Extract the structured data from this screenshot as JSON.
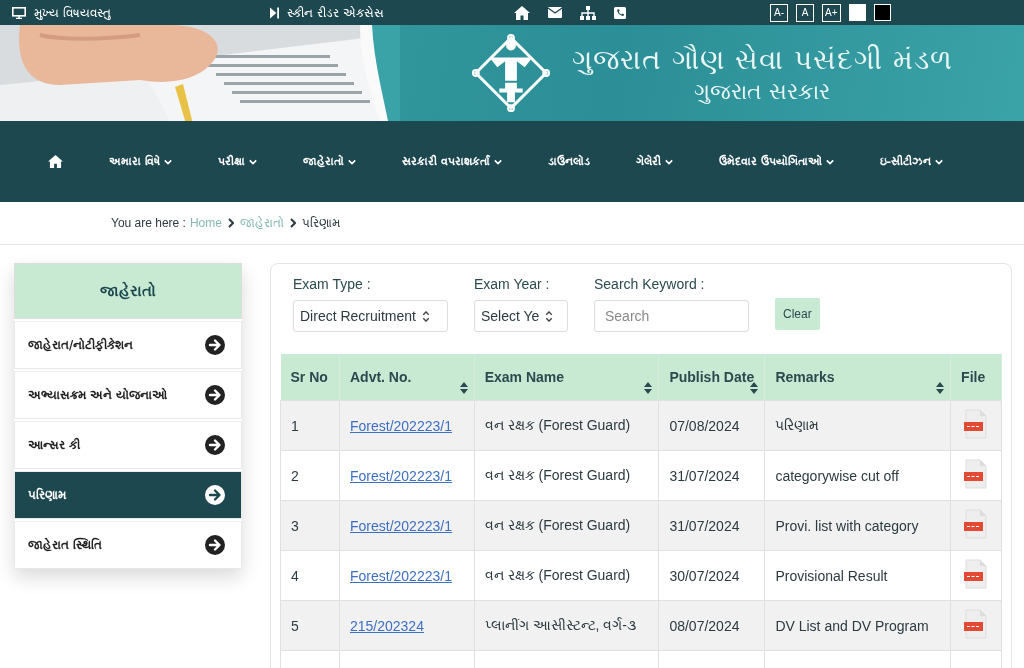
{
  "top_bar": {
    "skip_link": "મુખ્ય વિષયવસ્તુ",
    "screen_reader": "સ્કીન રીડર એક્સેસ",
    "font_buttons": [
      "A-",
      "A",
      "A+"
    ],
    "contrast_options": [
      {
        "color": "#ffffff"
      },
      {
        "color": "#000000"
      }
    ]
  },
  "banner": {
    "title": "ગુજરાત ગૌણ સેવા પસંદગી મંડળ",
    "subtitle": "ગુજરાત સરકાર"
  },
  "nav": [
    {
      "label": "અમારા વિષે",
      "dropdown": true
    },
    {
      "label": "પરીક્ષા",
      "dropdown": true
    },
    {
      "label": "જાહેરાતો",
      "dropdown": true
    },
    {
      "label": "સરકારી વપરાશકર્તા",
      "dropdown": true
    },
    {
      "label": "ડાઉનલોડ",
      "dropdown": false
    },
    {
      "label": "ગેલેરી",
      "dropdown": true
    },
    {
      "label": "ઉમેદવાર ઉપયોગિતાઓ",
      "dropdown": true
    },
    {
      "label": "ઇ-સીટીઝન",
      "dropdown": true
    }
  ],
  "breadcrumb": {
    "label": "You are here :",
    "links": [
      "Home",
      "જાહેરાતો"
    ],
    "current": "પરિણામ"
  },
  "sidebar": {
    "title": "જાહેરાતો",
    "items": [
      {
        "label": "જાહેરાત/નોટીફીકેશન",
        "selected": false
      },
      {
        "label": "અભ્યાસક્રમ અને યોજનાઓ",
        "selected": false
      },
      {
        "label": "આન્સર કી",
        "selected": false
      },
      {
        "label": "પરિણામ",
        "selected": true
      },
      {
        "label": "જાહેરાત સ્થિતિ",
        "selected": false
      }
    ]
  },
  "filters": {
    "exam_type": {
      "label": "Exam Type :",
      "value": "Direct Recruitment"
    },
    "exam_year": {
      "label": "Exam Year :",
      "value": "Select Ye"
    },
    "search": {
      "label": "Search Keyword :",
      "placeholder": "Search"
    },
    "clear_button": "Clear"
  },
  "table": {
    "columns": [
      {
        "label": "Sr No",
        "sortable": false
      },
      {
        "label": "Advt. No.",
        "sortable": true
      },
      {
        "label": "Exam Name",
        "sortable": true
      },
      {
        "label": "Publish Date",
        "sortable": true
      },
      {
        "label": "Remarks",
        "sortable": true
      },
      {
        "label": "File",
        "sortable": false
      }
    ],
    "rows": [
      {
        "sr": "1",
        "advt": "Forest/202223/1",
        "exam": "વન રક્ષક (Forest Guard)",
        "date": "07/08/2024",
        "remarks": "પરિણામ"
      },
      {
        "sr": "2",
        "advt": "Forest/202223/1",
        "exam": "વન રક્ષક (Forest Guard)",
        "date": "31/07/2024",
        "remarks": "categorywise cut off"
      },
      {
        "sr": "3",
        "advt": "Forest/202223/1",
        "exam": "વન રક્ષક (Forest Guard)",
        "date": "31/07/2024",
        "remarks": "Provi. list with category"
      },
      {
        "sr": "4",
        "advt": "Forest/202223/1",
        "exam": "વન રક્ષક (Forest Guard)",
        "date": "30/07/2024",
        "remarks": "Provisional Result"
      },
      {
        "sr": "5",
        "advt": "215/202324",
        "exam": "પ્લાનીંગ આસીસ્ટન્ટ, વર્ગ-૩",
        "date": "08/07/2024",
        "remarks": "DV List and DV Program"
      }
    ]
  }
}
